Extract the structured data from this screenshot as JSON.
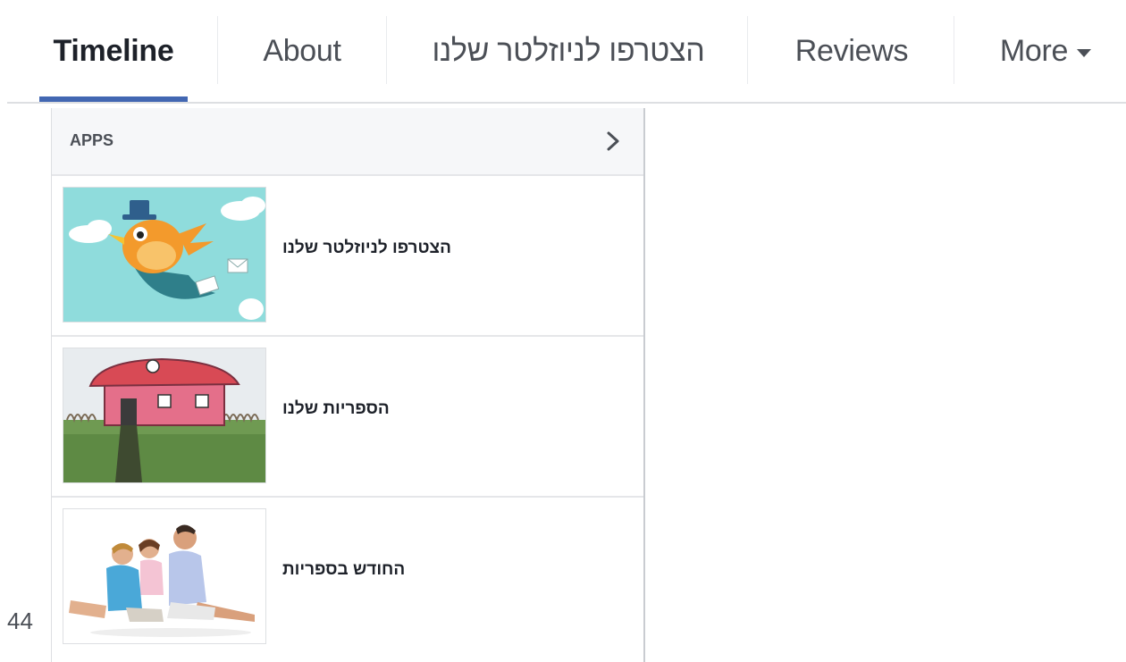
{
  "tabs": [
    {
      "label": "Timeline",
      "active": true
    },
    {
      "label": "About"
    },
    {
      "label": "הצטרפו לניוזלטר שלנו"
    },
    {
      "label": "Reviews"
    },
    {
      "label": "More"
    }
  ],
  "dropdown": {
    "header": "APPS",
    "items": [
      {
        "label": "הצטרפו לניוזלטר שלנו",
        "thumb": "newsletter-bird-image"
      },
      {
        "label": "הספריות שלנו",
        "thumb": "house-image"
      },
      {
        "label": "החודש בספריות",
        "thumb": "family-image"
      }
    ]
  },
  "page_number": "44",
  "colors": {
    "accent": "#4267b2",
    "text": "#1d2129",
    "muted": "#4b4f56"
  }
}
